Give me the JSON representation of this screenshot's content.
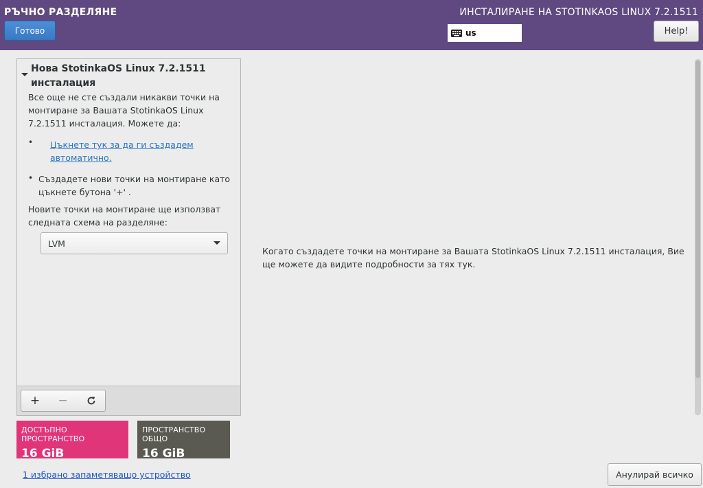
{
  "header": {
    "spoke_title": "РЪЧНО РАЗДЕЛЯНЕ",
    "done_label": "Готово",
    "product_title": "ИНСТАЛИРАНЕ НА STOTINKAOS LINUX 7.2.1511",
    "keyboard_layout": "us",
    "keyboard_icon": "keyboard-icon",
    "help_label": "Help!"
  },
  "installation": {
    "title": "Нова StotinkaOS Linux 7.2.1511 инсталация",
    "expander_icon": "triangle-down-icon",
    "no_mountpoints_text": "Все още не сте създали никакви точки на монтиране за Вашата StotinkaOS Linux 7.2.1511 инсталация.  Можете да:",
    "bullet": "•",
    "auto_create_link": "Цъкнете тук за да ги създадем автоматично.",
    "new_mountpoint_text": "Създадете нови точки на монтиране като цъкнете бутона '+' .",
    "scheme_text": "Новите точки на монтиране ще използват следната схема на разделяне:",
    "scheme_selected": "LVM"
  },
  "toolbar": {
    "add_label": "+",
    "remove_label": "−",
    "refresh_icon": "refresh-icon"
  },
  "space": {
    "available_label": "ДОСТЪПНО ПРОСТРАНСТВО",
    "available_value": "16 GiB",
    "total_label": "ПРОСТРАНСТВО ОБЩО",
    "total_value": "16 GiB",
    "colors": {
      "available": "#e13579",
      "total": "#5a5a52"
    }
  },
  "storage_link": "1 избрано запаметяващо устройство",
  "right_info": "Когато създадете точки на монтиране за Вашата StotinkaOS Linux 7.2.1511 инсталация, Вие ще можете да видите подробности за тях тук.",
  "reset_label": "Анулирай всичко",
  "colors": {
    "header_bg": "#5f4980",
    "done_button": "#3a78c2",
    "link": "#2a76c6"
  }
}
